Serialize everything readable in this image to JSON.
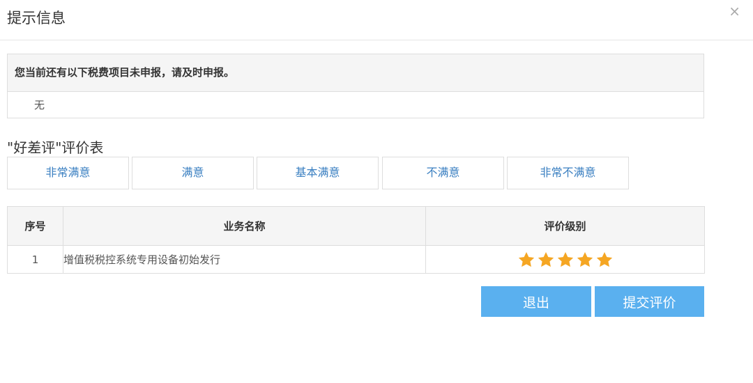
{
  "dialog": {
    "title": "提示信息",
    "close_glyph": "×"
  },
  "notice": {
    "heading": "您当前还有以下税费项目未申报，请及时申报。",
    "content": "无"
  },
  "rating": {
    "title": "\"好差评\"评价表",
    "options": [
      "非常满意",
      "满意",
      "基本满意",
      "不满意",
      "非常不满意"
    ]
  },
  "table": {
    "headers": {
      "index": "序号",
      "name": "业务名称",
      "rating": "评价级别"
    },
    "rows": [
      {
        "index": "1",
        "name": "增值税税控系统专用设备初始发行",
        "stars": 5,
        "max_stars": 5
      }
    ]
  },
  "buttons": {
    "exit": "退出",
    "submit": "提交评价"
  },
  "colors": {
    "accent": "#5ab0ef",
    "link": "#3a7fc1",
    "star": "#f5a623"
  }
}
